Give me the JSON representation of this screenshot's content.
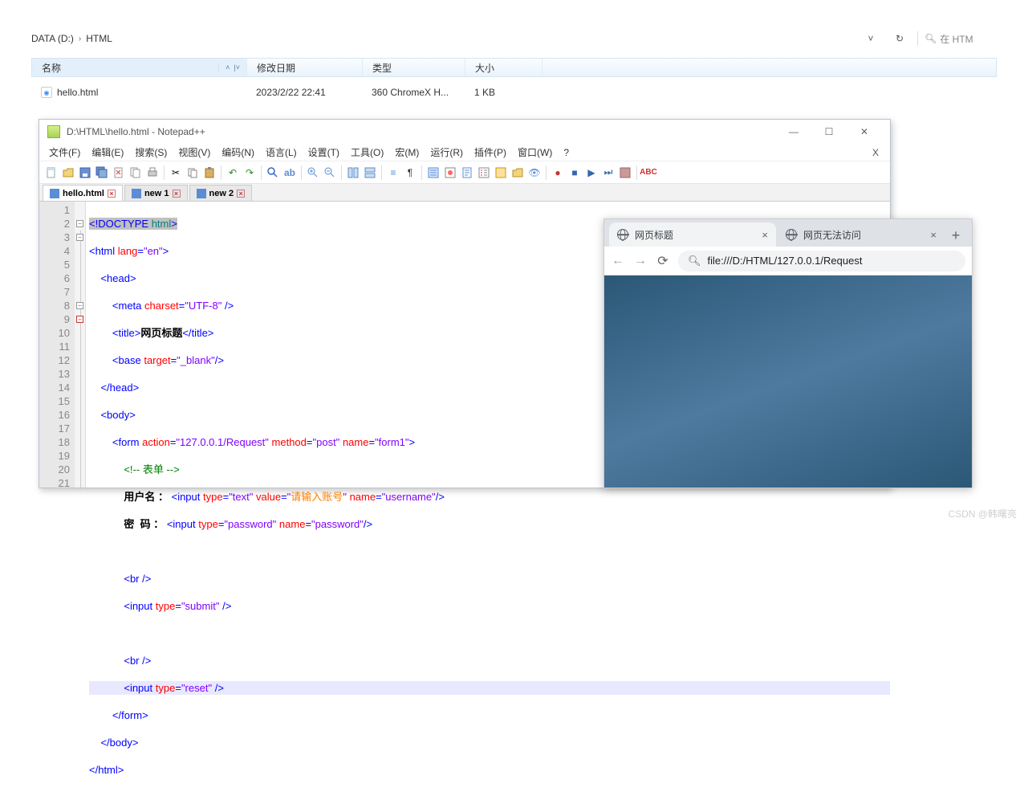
{
  "explorer": {
    "breadcrumb": [
      "DATA (D:)",
      "HTML"
    ],
    "refresh_icon": "refresh-icon",
    "search_placeholder": "在 HTM",
    "columns": {
      "name": "名称",
      "modified": "修改日期",
      "type": "类型",
      "size": "大小"
    },
    "file": {
      "name": "hello.html",
      "modified": "2023/2/22 22:41",
      "type": "360 ChromeX H...",
      "size": "1 KB"
    }
  },
  "notepad": {
    "title": "D:\\HTML\\hello.html - Notepad++",
    "menu": [
      "文件(F)",
      "编辑(E)",
      "搜索(S)",
      "视图(V)",
      "编码(N)",
      "语言(L)",
      "设置(T)",
      "工具(O)",
      "宏(M)",
      "运行(R)",
      "插件(P)",
      "窗口(W)",
      "?"
    ],
    "tabs": [
      {
        "label": "hello.html",
        "active": true
      },
      {
        "label": "new 1",
        "active": false
      },
      {
        "label": "new 2",
        "active": false
      }
    ],
    "code": {
      "lines": 21,
      "l1_doctype": "!DOCTYPE",
      "l1_html": "html",
      "l2_tag": "html",
      "l2_attr": "lang",
      "l2_val": "\"en\"",
      "l3": "head",
      "l4_tag": "meta",
      "l4_attr": "charset",
      "l4_val": "\"UTF-8\"",
      "l5_tag": "title",
      "l5_text": "网页标题",
      "l6_tag": "base",
      "l6_attr": "target",
      "l6_val": "\"_blank\"",
      "l7": "head",
      "l8": "body",
      "l9_tag": "form",
      "l9_a1": "action",
      "l9_v1": "\"127.0.0.1/Request\"",
      "l9_a2": "method",
      "l9_v2": "\"post\"",
      "l9_a3": "name",
      "l9_v3": "\"form1\"",
      "l10_comment": "<!-- 表单 -->",
      "l11_label": "用户名 ：",
      "l11_tag": "input",
      "l11_a1": "type",
      "l11_v1": "\"text\"",
      "l11_a2": "value",
      "l11_v2": "\"请输入账号\"",
      "l11_a3": "name",
      "l11_v3": "\"username\"",
      "l12_label": "密  码 ：",
      "l12_tag": "input",
      "l12_a1": "type",
      "l12_v1": "\"password\"",
      "l12_a2": "name",
      "l12_v2": "\"password\"",
      "l14": "br",
      "l15_tag": "input",
      "l15_a1": "type",
      "l15_v1": "\"submit\"",
      "l17": "br",
      "l18_tag": "input",
      "l18_a1": "type",
      "l18_v1": "\"reset\"",
      "l19": "form",
      "l20": "body",
      "l21": "html"
    }
  },
  "browser": {
    "tabs": [
      {
        "title": "网页标题",
        "active": false
      },
      {
        "title": "网页无法访问",
        "active": true
      }
    ],
    "url": "file:///D:/HTML/127.0.0.1/Request"
  },
  "watermark": "CSDN @韩曙亮"
}
